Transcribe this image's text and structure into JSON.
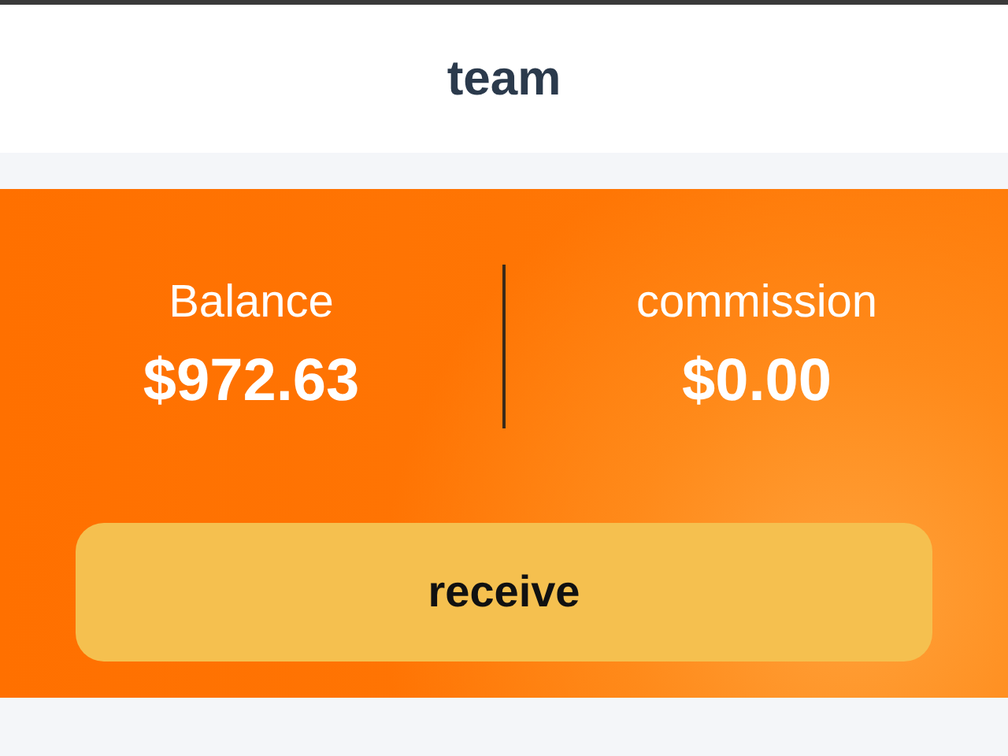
{
  "header": {
    "title": "team"
  },
  "stats": [
    {
      "label": "Balance",
      "value": "$972.63"
    },
    {
      "label": "commission",
      "value": "$0.00"
    }
  ],
  "action": {
    "label": "receive"
  }
}
